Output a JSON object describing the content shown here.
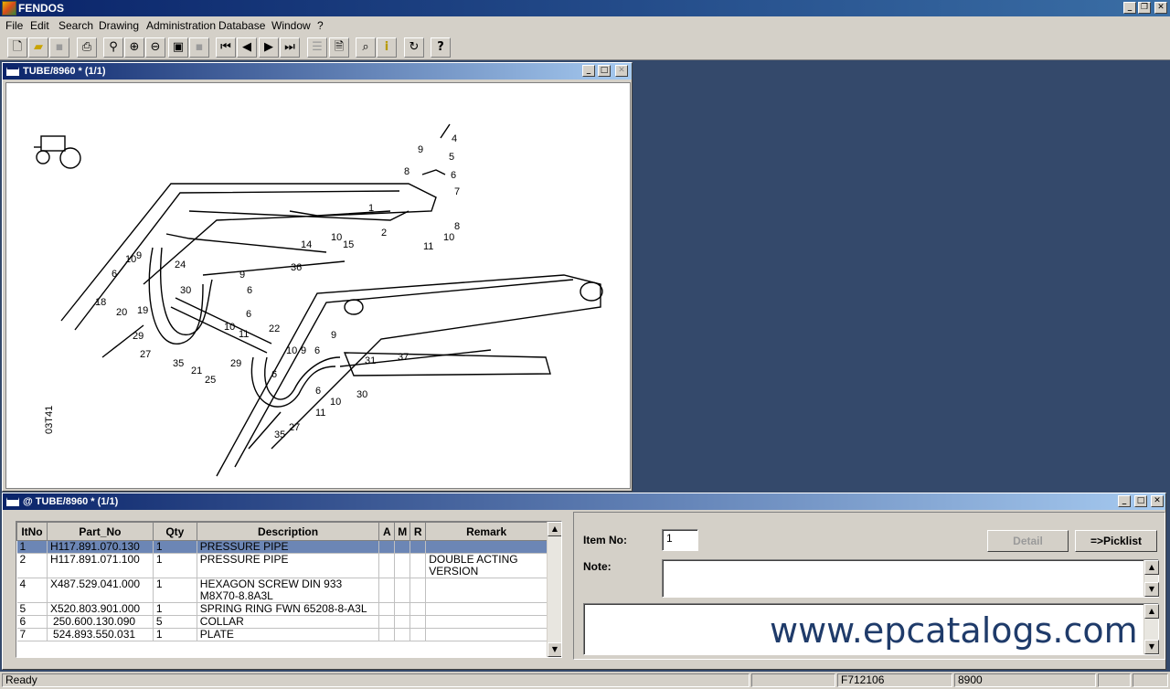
{
  "app": {
    "title": "FENDOS",
    "minimize": "_",
    "restore": "❐",
    "close": "✕"
  },
  "menu": [
    "File",
    "Edit",
    "Search",
    "Drawing",
    "Administration",
    "Database",
    "Window",
    "?"
  ],
  "toolbar": {
    "new": "new-icon",
    "open": "open-folder-icon",
    "save": "save-icon",
    "print": "print-icon",
    "search": "search-icon",
    "zoom_in": "zoom-in-icon",
    "zoom_out": "zoom-out-icon",
    "fit": "fit-page-icon",
    "blank": "blank-icon",
    "first": "first-icon",
    "prev": "previous-icon",
    "next": "next-icon",
    "last": "last-icon",
    "list": "list-icon",
    "doc": "document-icon",
    "find": "binoculars-icon",
    "info": "info-icon",
    "refresh": "refresh-icon",
    "help": "help-icon"
  },
  "drawing_window": {
    "title": "TUBE/8960 * (1/1)",
    "drawing_code": "03T41",
    "callouts": [
      "1",
      "2",
      "4",
      "5",
      "6",
      "7",
      "8",
      "8",
      "9",
      "10",
      "11",
      "14",
      "15",
      "36",
      "10",
      "9",
      "6",
      "24",
      "18",
      "20",
      "19",
      "30",
      "29",
      "27",
      "35",
      "21",
      "25",
      "9",
      "6",
      "6",
      "10",
      "11",
      "22",
      "29",
      "9",
      "6",
      "10",
      "9",
      "6",
      "31",
      "37",
      "30",
      "6",
      "10",
      "11",
      "27",
      "35"
    ]
  },
  "parts_window": {
    "title": "@ TUBE/8960 * (1/1)",
    "columns": [
      "ItNo",
      "Part_No",
      "Qty",
      "Description",
      "A",
      "M",
      "R",
      "Remark"
    ],
    "rows": [
      {
        "itno": "1",
        "part_no": "H117.891.070.130",
        "qty": "1",
        "description": "PRESSURE PIPE",
        "a": "",
        "m": "",
        "r": "",
        "remark": ""
      },
      {
        "itno": "2",
        "part_no": "H117.891.071.100",
        "qty": "1",
        "description": "PRESSURE PIPE",
        "a": "",
        "m": "",
        "r": "",
        "remark": "DOUBLE ACTING\nVERSION"
      },
      {
        "itno": "4",
        "part_no": "X487.529.041.000",
        "qty": "1",
        "description": "HEXAGON SCREW DIN 933\nM8X70-8.8A3L",
        "a": "",
        "m": "",
        "r": "",
        "remark": ""
      },
      {
        "itno": "5",
        "part_no": "X520.803.901.000",
        "qty": "1",
        "description": "SPRING RING FWN 65208-8-A3L",
        "a": "",
        "m": "",
        "r": "",
        "remark": ""
      },
      {
        "itno": "6",
        "part_no": "250.600.130.090",
        "qty": "5",
        "description": "COLLAR",
        "a": "",
        "m": "",
        "r": "",
        "remark": ""
      },
      {
        "itno": "7",
        "part_no": "524.893.550.031",
        "qty": "1",
        "description": "PLATE",
        "a": "",
        "m": "",
        "r": "",
        "remark": ""
      }
    ],
    "item_no_label": "Item No:",
    "item_no_value": "1",
    "note_label": "Note:",
    "detail_button": "Detail",
    "picklist_button": "=>Picklist",
    "watermark": "www.epcatalogs.com"
  },
  "status": {
    "text": "Ready",
    "code": "F712106",
    "number": "8900"
  }
}
